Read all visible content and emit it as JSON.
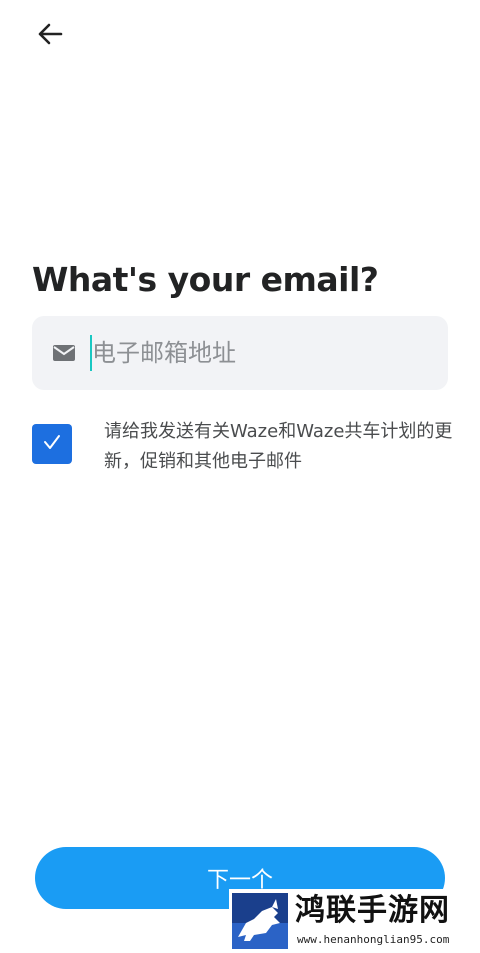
{
  "header": {
    "back_icon": "arrow-left-icon"
  },
  "main": {
    "title": "What's your email?",
    "email_field": {
      "icon": "mail-icon",
      "placeholder": "电子邮箱地址",
      "value": ""
    },
    "consent": {
      "checked": true,
      "icon": "checkmark-icon",
      "text": "请给我发送有关Waze和Waze共车计划的更新，促销和其他电子邮件"
    }
  },
  "footer": {
    "next_label": "下一个"
  },
  "watermark": {
    "title": "鸿联手游网",
    "url": "www.henanhonglian95.com"
  },
  "colors": {
    "primary_button": "#1a9cf4",
    "checkbox": "#1d6fe0",
    "caret": "#19c7c2",
    "input_bg": "#f2f3f6",
    "title": "#222324"
  }
}
